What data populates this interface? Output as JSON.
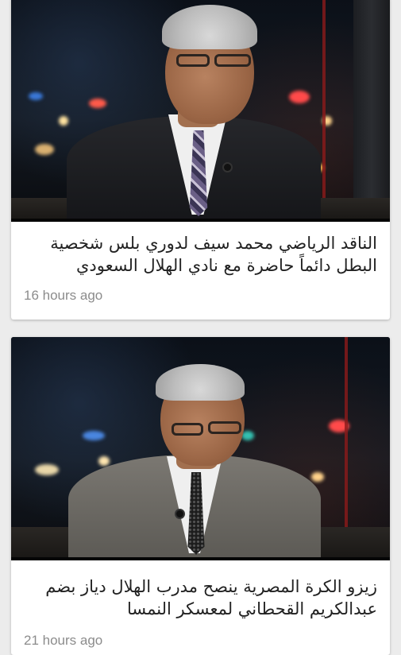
{
  "feed": {
    "articles": [
      {
        "title": "الناقد الرياضي محمد سيف لدوري بلس شخصية البطل دائماً حاضرة مع نادي الهلال السعودي",
        "time": "16 hours ago",
        "image": "man-in-suit-interview-photo"
      },
      {
        "title": "زيزو الكرة المصرية ينصح مدرب الهلال دياز بضم عبدالكريم القحطاني لمعسكر النمسا",
        "time": "21 hours ago",
        "image": "older-man-in-gray-suit-interview-photo"
      }
    ]
  },
  "colors": {
    "background": "#ececec",
    "card": "#ffffff",
    "title_text": "#222222",
    "time_text": "#8c8c8c"
  }
}
